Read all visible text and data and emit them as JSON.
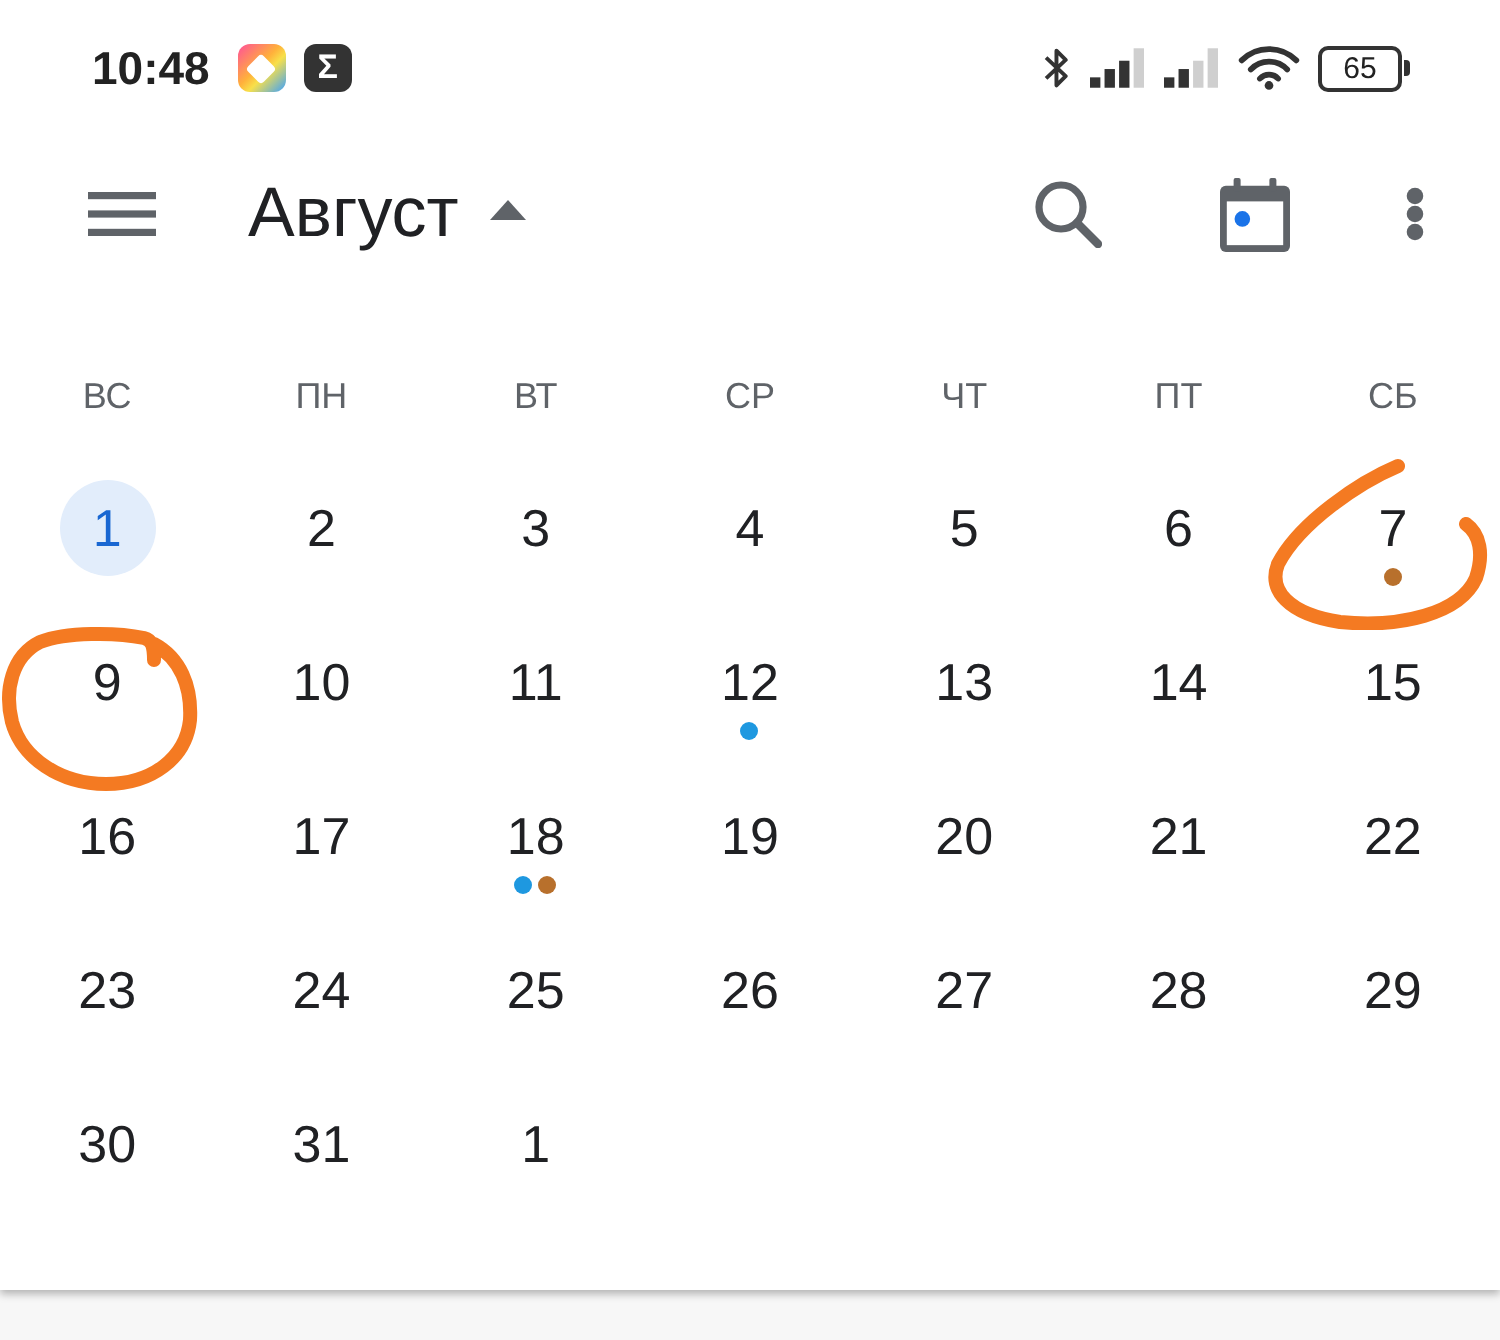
{
  "status_bar": {
    "time": "10:48",
    "app_icons": [
      {
        "kind": "colorful"
      },
      {
        "kind": "letter",
        "text": "Σ"
      }
    ],
    "battery": "65"
  },
  "toolbar": {
    "title": "Август"
  },
  "weekdays": [
    "ВС",
    "ПН",
    "ВТ",
    "СР",
    "ЧТ",
    "ПТ",
    "СБ"
  ],
  "weeks": [
    {
      "days": [
        {
          "label": "1",
          "selected": true,
          "circled": false
        },
        {
          "label": "2",
          "selected": false,
          "circled": false
        },
        {
          "label": "3",
          "selected": false,
          "circled": false
        },
        {
          "label": "4",
          "selected": false,
          "circled": false
        },
        {
          "label": "5",
          "selected": false,
          "circled": false
        },
        {
          "label": "6",
          "selected": false,
          "circled": false
        },
        {
          "label": "7",
          "selected": false,
          "circled": true,
          "events": [
            {
              "color": "#b8702c"
            }
          ]
        }
      ]
    },
    {
      "days": [
        {
          "label": "9",
          "selected": false,
          "circled": true
        },
        {
          "label": "10",
          "selected": false,
          "circled": false
        },
        {
          "label": "11",
          "selected": false,
          "circled": false
        },
        {
          "label": "12",
          "selected": false,
          "circled": false,
          "events": [
            {
              "color": "#1e98e0"
            }
          ]
        },
        {
          "label": "13",
          "selected": false,
          "circled": false
        },
        {
          "label": "14",
          "selected": false,
          "circled": false
        },
        {
          "label": "15",
          "selected": false,
          "circled": false
        }
      ]
    },
    {
      "days": [
        {
          "label": "16",
          "selected": false,
          "circled": false
        },
        {
          "label": "17",
          "selected": false,
          "circled": false
        },
        {
          "label": "18",
          "selected": false,
          "circled": false,
          "events": [
            {
              "color": "#1e98e0"
            },
            {
              "color": "#b8702c"
            }
          ]
        },
        {
          "label": "19",
          "selected": false,
          "circled": false
        },
        {
          "label": "20",
          "selected": false,
          "circled": false
        },
        {
          "label": "21",
          "selected": false,
          "circled": false
        },
        {
          "label": "22",
          "selected": false,
          "circled": false
        }
      ]
    },
    {
      "days": [
        {
          "label": "23",
          "selected": false,
          "circled": false
        },
        {
          "label": "24",
          "selected": false,
          "circled": false
        },
        {
          "label": "25",
          "selected": false,
          "circled": false
        },
        {
          "label": "26",
          "selected": false,
          "circled": false
        },
        {
          "label": "27",
          "selected": false,
          "circled": false
        },
        {
          "label": "28",
          "selected": false,
          "circled": false
        },
        {
          "label": "29",
          "selected": false,
          "circled": false
        }
      ]
    },
    {
      "days": [
        {
          "label": "30",
          "selected": false,
          "circled": false
        },
        {
          "label": "31",
          "selected": false,
          "circled": false
        },
        {
          "label": "1",
          "selected": false,
          "circled": false
        }
      ]
    }
  ]
}
